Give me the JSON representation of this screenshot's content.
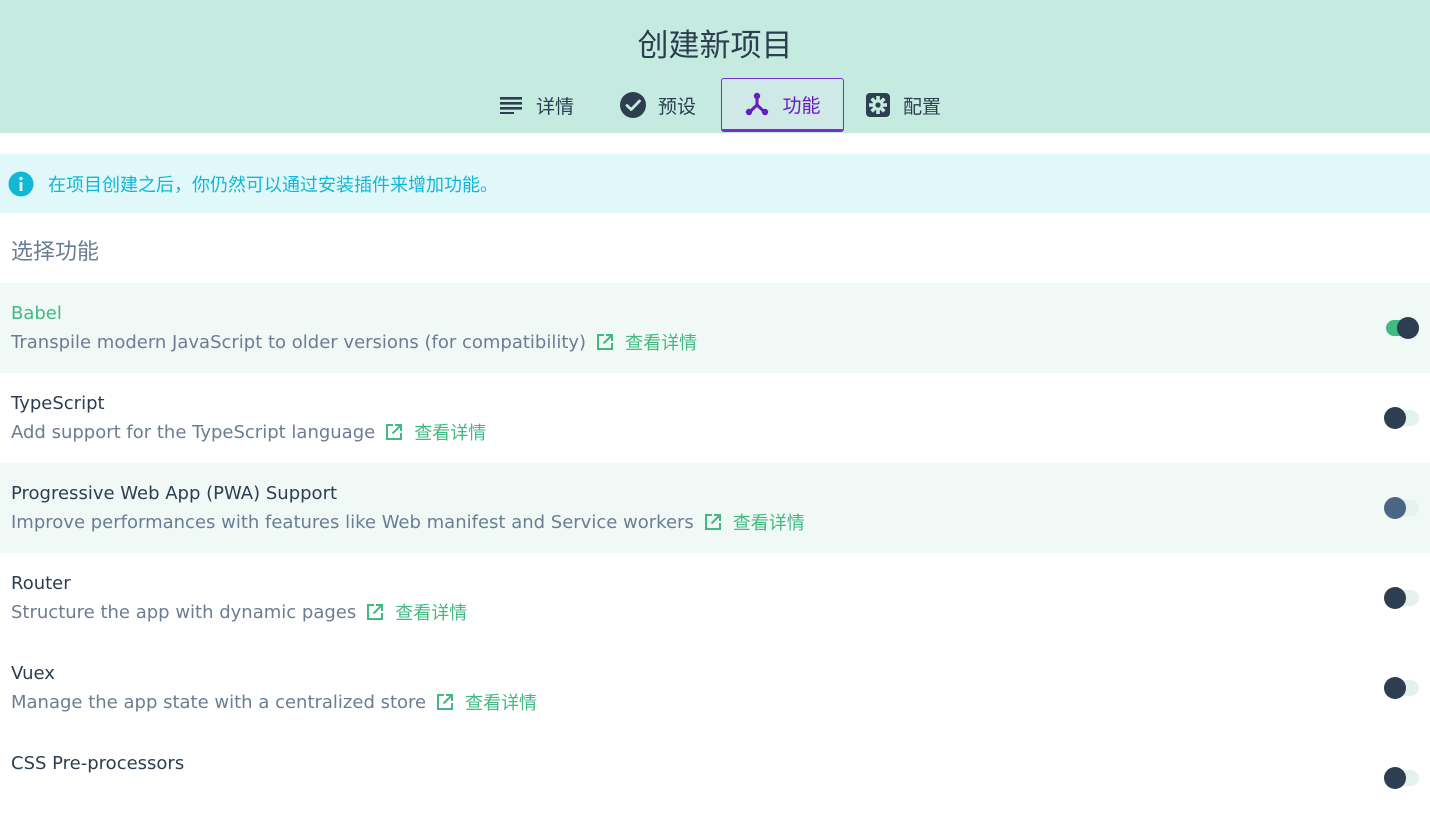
{
  "header": {
    "title": "创建新项目",
    "tabs": [
      {
        "label": "详情",
        "icon": "list-icon"
      },
      {
        "label": "预设",
        "icon": "check-circle-icon"
      },
      {
        "label": "功能",
        "icon": "fork-icon"
      },
      {
        "label": "配置",
        "icon": "gear-icon"
      }
    ],
    "active_tab": "功能"
  },
  "info": {
    "icon": "info-icon",
    "text": "在项目创建之后，你仍然可以通过安装插件来增加功能。"
  },
  "section_title": "选择功能",
  "features": [
    {
      "name": "Babel",
      "description": "Transpile modern JavaScript to older versions (for compatibility)",
      "more": "查看详情",
      "enabled": true
    },
    {
      "name": "TypeScript",
      "description": "Add support for the TypeScript language",
      "more": "查看详情",
      "enabled": false
    },
    {
      "name": "Progressive Web App (PWA) Support",
      "description": "Improve performances with features like Web manifest and Service workers",
      "more": "查看详情",
      "enabled": false
    },
    {
      "name": "Router",
      "description": "Structure the app with dynamic pages",
      "more": "查看详情",
      "enabled": false
    },
    {
      "name": "Vuex",
      "description": "Manage the app state with a centralized store",
      "more": "查看详情",
      "enabled": false
    },
    {
      "name": "CSS Pre-processors",
      "description": "",
      "more": "",
      "enabled": false
    }
  ],
  "colors": {
    "header_bg": "#c5eadf",
    "accent": "#42b983",
    "active_tab": "#7b2ecf",
    "info": "#10b8d6",
    "text_dark": "#2c3e50",
    "text_muted": "#6b7d94"
  }
}
